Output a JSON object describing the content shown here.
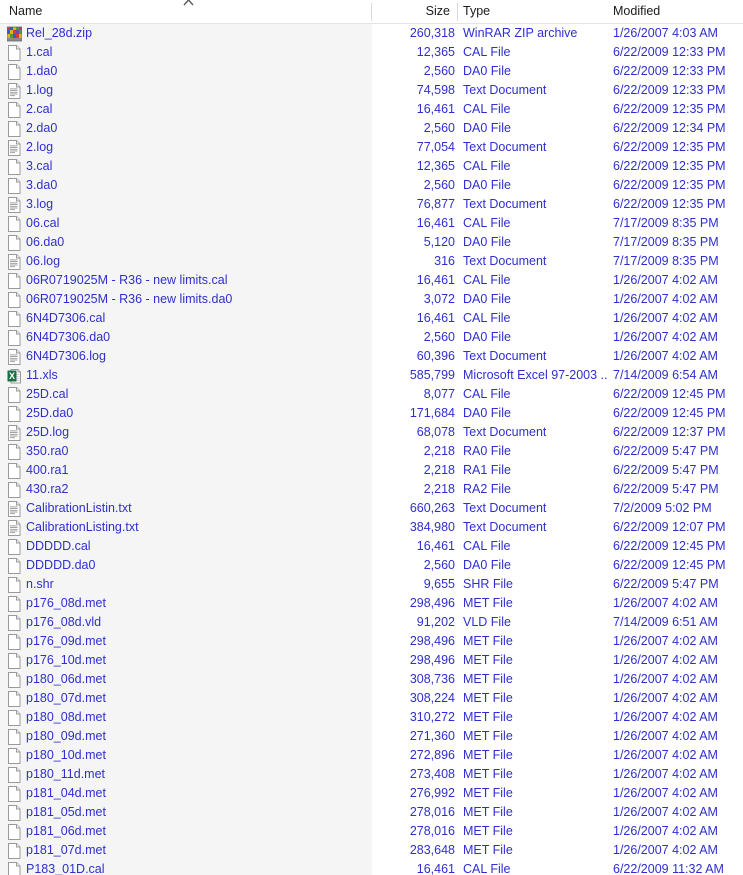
{
  "columns": {
    "name": "Name",
    "size": "Size",
    "type": "Type",
    "modified": "Modified",
    "sort_icon": "sort-ascending-chevron-icon"
  },
  "colors": {
    "item_text": "#2f2fd0",
    "header_text": "#1b1b1b",
    "name_pane_bg": "#f5f5f5",
    "list_bg": "#ffffff",
    "divider": "#d9d9d9"
  },
  "files": [
    {
      "name": "Rel_28d.zip",
      "size": "260,318",
      "type": "WinRAR ZIP archive",
      "modified": "1/26/2007 4:03 AM",
      "icon": "winrar-zip-icon"
    },
    {
      "name": "1.cal",
      "size": "12,365",
      "type": "CAL File",
      "modified": "6/22/2009 12:33 PM",
      "icon": "blank-file-icon"
    },
    {
      "name": "1.da0",
      "size": "2,560",
      "type": "DA0 File",
      "modified": "6/22/2009 12:33 PM",
      "icon": "blank-file-icon"
    },
    {
      "name": "1.log",
      "size": "74,598",
      "type": "Text Document",
      "modified": "6/22/2009 12:33 PM",
      "icon": "text-document-icon"
    },
    {
      "name": "2.cal",
      "size": "16,461",
      "type": "CAL File",
      "modified": "6/22/2009 12:35 PM",
      "icon": "blank-file-icon"
    },
    {
      "name": "2.da0",
      "size": "2,560",
      "type": "DA0 File",
      "modified": "6/22/2009 12:34 PM",
      "icon": "blank-file-icon"
    },
    {
      "name": "2.log",
      "size": "77,054",
      "type": "Text Document",
      "modified": "6/22/2009 12:35 PM",
      "icon": "text-document-icon"
    },
    {
      "name": "3.cal",
      "size": "12,365",
      "type": "CAL File",
      "modified": "6/22/2009 12:35 PM",
      "icon": "blank-file-icon"
    },
    {
      "name": "3.da0",
      "size": "2,560",
      "type": "DA0 File",
      "modified": "6/22/2009 12:35 PM",
      "icon": "blank-file-icon"
    },
    {
      "name": "3.log",
      "size": "76,877",
      "type": "Text Document",
      "modified": "6/22/2009 12:35 PM",
      "icon": "text-document-icon"
    },
    {
      "name": "06.cal",
      "size": "16,461",
      "type": "CAL File",
      "modified": "7/17/2009 8:35 PM",
      "icon": "blank-file-icon"
    },
    {
      "name": "06.da0",
      "size": "5,120",
      "type": "DA0 File",
      "modified": "7/17/2009 8:35 PM",
      "icon": "blank-file-icon"
    },
    {
      "name": "06.log",
      "size": "316",
      "type": "Text Document",
      "modified": "7/17/2009 8:35 PM",
      "icon": "text-document-icon"
    },
    {
      "name": "06R0719025M - R36 - new limits.cal",
      "size": "16,461",
      "type": "CAL File",
      "modified": "1/26/2007 4:02 AM",
      "icon": "blank-file-icon"
    },
    {
      "name": "06R0719025M - R36 - new limits.da0",
      "size": "3,072",
      "type": "DA0 File",
      "modified": "1/26/2007 4:02 AM",
      "icon": "blank-file-icon"
    },
    {
      "name": "6N4D7306.cal",
      "size": "16,461",
      "type": "CAL File",
      "modified": "1/26/2007 4:02 AM",
      "icon": "blank-file-icon"
    },
    {
      "name": "6N4D7306.da0",
      "size": "2,560",
      "type": "DA0 File",
      "modified": "1/26/2007 4:02 AM",
      "icon": "blank-file-icon"
    },
    {
      "name": "6N4D7306.log",
      "size": "60,396",
      "type": "Text Document",
      "modified": "1/26/2007 4:02 AM",
      "icon": "text-document-icon"
    },
    {
      "name": "11.xls",
      "size": "585,799",
      "type": "Microsoft Excel 97-2003 ...",
      "modified": "7/14/2009 6:54 AM",
      "icon": "excel-icon"
    },
    {
      "name": "25D.cal",
      "size": "8,077",
      "type": "CAL File",
      "modified": "6/22/2009 12:45 PM",
      "icon": "blank-file-icon"
    },
    {
      "name": "25D.da0",
      "size": "171,684",
      "type": "DA0 File",
      "modified": "6/22/2009 12:45 PM",
      "icon": "blank-file-icon"
    },
    {
      "name": "25D.log",
      "size": "68,078",
      "type": "Text Document",
      "modified": "6/22/2009 12:37 PM",
      "icon": "text-document-icon"
    },
    {
      "name": "350.ra0",
      "size": "2,218",
      "type": "RA0 File",
      "modified": "6/22/2009 5:47 PM",
      "icon": "blank-file-icon"
    },
    {
      "name": "400.ra1",
      "size": "2,218",
      "type": "RA1 File",
      "modified": "6/22/2009 5:47 PM",
      "icon": "blank-file-icon"
    },
    {
      "name": "430.ra2",
      "size": "2,218",
      "type": "RA2 File",
      "modified": "6/22/2009 5:47 PM",
      "icon": "blank-file-icon"
    },
    {
      "name": "CalibrationListin.txt",
      "size": "660,263",
      "type": "Text Document",
      "modified": "7/2/2009 5:02 PM",
      "icon": "text-document-icon"
    },
    {
      "name": "CalibrationListing.txt",
      "size": "384,980",
      "type": "Text Document",
      "modified": "6/22/2009 12:07 PM",
      "icon": "text-document-icon"
    },
    {
      "name": "DDDDD.cal",
      "size": "16,461",
      "type": "CAL File",
      "modified": "6/22/2009 12:45 PM",
      "icon": "blank-file-icon"
    },
    {
      "name": "DDDDD.da0",
      "size": "2,560",
      "type": "DA0 File",
      "modified": "6/22/2009 12:45 PM",
      "icon": "blank-file-icon"
    },
    {
      "name": "n.shr",
      "size": "9,655",
      "type": "SHR File",
      "modified": "6/22/2009 5:47 PM",
      "icon": "blank-file-icon"
    },
    {
      "name": "p176_08d.met",
      "size": "298,496",
      "type": "MET File",
      "modified": "1/26/2007 4:02 AM",
      "icon": "blank-file-icon"
    },
    {
      "name": "p176_08d.vld",
      "size": "91,202",
      "type": "VLD File",
      "modified": "7/14/2009 6:51 AM",
      "icon": "blank-file-icon"
    },
    {
      "name": "p176_09d.met",
      "size": "298,496",
      "type": "MET File",
      "modified": "1/26/2007 4:02 AM",
      "icon": "blank-file-icon"
    },
    {
      "name": "p176_10d.met",
      "size": "298,496",
      "type": "MET File",
      "modified": "1/26/2007 4:02 AM",
      "icon": "blank-file-icon"
    },
    {
      "name": "p180_06d.met",
      "size": "308,736",
      "type": "MET File",
      "modified": "1/26/2007 4:02 AM",
      "icon": "blank-file-icon"
    },
    {
      "name": "p180_07d.met",
      "size": "308,224",
      "type": "MET File",
      "modified": "1/26/2007 4:02 AM",
      "icon": "blank-file-icon"
    },
    {
      "name": "p180_08d.met",
      "size": "310,272",
      "type": "MET File",
      "modified": "1/26/2007 4:02 AM",
      "icon": "blank-file-icon"
    },
    {
      "name": "p180_09d.met",
      "size": "271,360",
      "type": "MET File",
      "modified": "1/26/2007 4:02 AM",
      "icon": "blank-file-icon"
    },
    {
      "name": "p180_10d.met",
      "size": "272,896",
      "type": "MET File",
      "modified": "1/26/2007 4:02 AM",
      "icon": "blank-file-icon"
    },
    {
      "name": "p180_11d.met",
      "size": "273,408",
      "type": "MET File",
      "modified": "1/26/2007 4:02 AM",
      "icon": "blank-file-icon"
    },
    {
      "name": "p181_04d.met",
      "size": "276,992",
      "type": "MET File",
      "modified": "1/26/2007 4:02 AM",
      "icon": "blank-file-icon"
    },
    {
      "name": "p181_05d.met",
      "size": "278,016",
      "type": "MET File",
      "modified": "1/26/2007 4:02 AM",
      "icon": "blank-file-icon"
    },
    {
      "name": "p181_06d.met",
      "size": "278,016",
      "type": "MET File",
      "modified": "1/26/2007 4:02 AM",
      "icon": "blank-file-icon"
    },
    {
      "name": "p181_07d.met",
      "size": "283,648",
      "type": "MET File",
      "modified": "1/26/2007 4:02 AM",
      "icon": "blank-file-icon"
    },
    {
      "name": "P183_01D.cal",
      "size": "16,461",
      "type": "CAL File",
      "modified": "6/22/2009 11:32 AM",
      "icon": "blank-file-icon"
    }
  ]
}
